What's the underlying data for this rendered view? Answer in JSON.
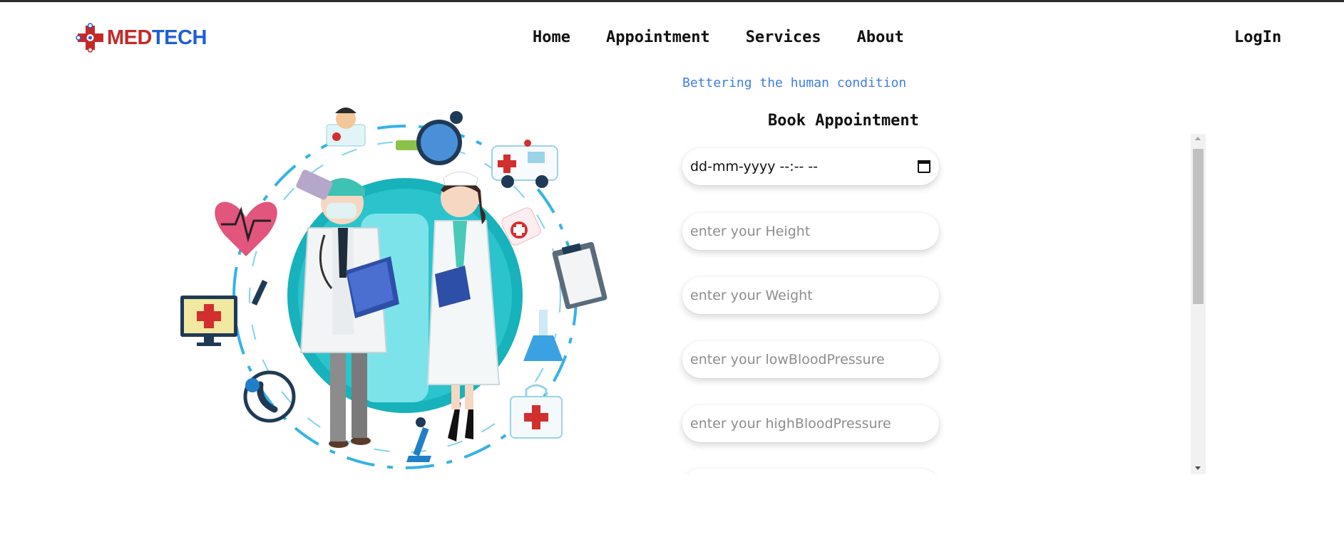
{
  "header": {
    "logo_text_red": "MED",
    "logo_text_blue": "TECH",
    "nav": [
      "Home",
      "Appointment",
      "Services",
      "About"
    ],
    "login_label": "LogIn"
  },
  "hero": {
    "tagline": "Bettering the human condition"
  },
  "form": {
    "title": "Book Appointment",
    "date_value": "dd-mm-yyyy --:-- --",
    "height_placeholder": "enter your Height",
    "weight_placeholder": "enter your Weight",
    "low_bp_placeholder": "enter your lowBloodPressure",
    "high_bp_placeholder": "enter your highBloodPressure"
  },
  "colors": {
    "brand_red": "#c62828",
    "brand_blue": "#1e5fd8",
    "tagline_blue": "#3d7de8",
    "teal": "#19b6be"
  },
  "icons": [
    "calendar-icon",
    "logo-medical-cross-icon",
    "scroll-up-arrow-icon",
    "scroll-down-arrow-icon"
  ]
}
